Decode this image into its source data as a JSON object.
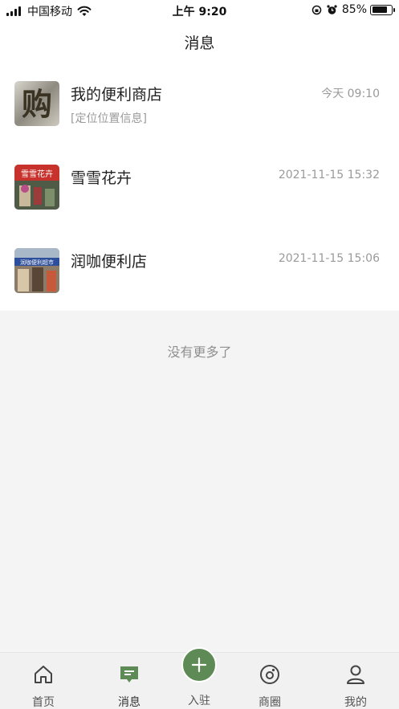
{
  "status_bar": {
    "carrier": "中国移动",
    "time": "上午 9:20",
    "battery": "85%",
    "battery_level": 0.85
  },
  "nav": {
    "title": "消息"
  },
  "messages": [
    {
      "name": "我的便利商店",
      "time": "今天 09:10",
      "preview": "[定位位置信息]"
    },
    {
      "name": "雪雪花卉",
      "time": "2021-11-15 15:32",
      "preview": ""
    },
    {
      "name": "润咖便利店",
      "time": "2021-11-15 15:06",
      "preview": ""
    }
  ],
  "avatars": {
    "shop1_char": "购",
    "shop2_sign": "雪雪花卉",
    "shop3_sign": "润咖便利超市"
  },
  "no_more": "没有更多了",
  "tabs": {
    "home": "首页",
    "messages": "消息",
    "join": "入驻",
    "circle": "商圈",
    "mine": "我的"
  },
  "colors": {
    "accent": "#5e8a55",
    "text_secondary": "#9a9a9a",
    "page_bg": "#f4f4f4"
  }
}
